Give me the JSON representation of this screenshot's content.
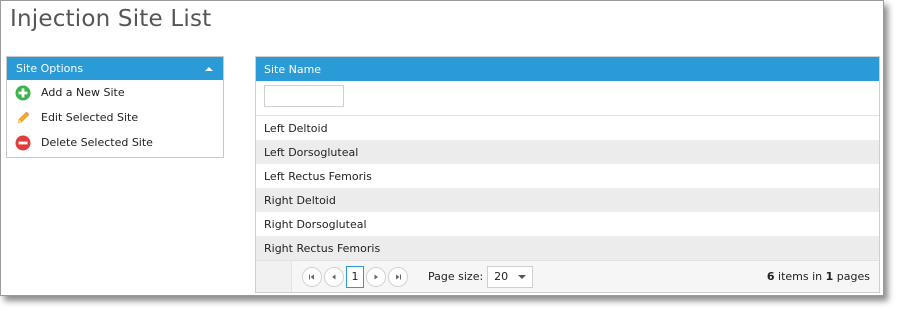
{
  "page": {
    "title": "Injection Site List"
  },
  "options_panel": {
    "header": "Site Options",
    "items": [
      {
        "label": "Add a New Site",
        "icon": "add-circle-icon",
        "color": "#3cb34a"
      },
      {
        "label": "Edit Selected Site",
        "icon": "pencil-icon",
        "color": "#f0b323"
      },
      {
        "label": "Delete Selected Site",
        "icon": "remove-circle-icon",
        "color": "#e23b3b"
      }
    ]
  },
  "grid": {
    "column_header": "Site Name",
    "filter_value": "",
    "rows": [
      "Left Deltoid",
      "Left Dorsogluteal",
      "Left Rectus Femoris",
      "Right Deltoid",
      "Right Dorsogluteal",
      "Right Rectus Femoris"
    ],
    "pager": {
      "current_page": "1",
      "page_size_label": "Page size:",
      "page_size_value": "20",
      "item_count": "6",
      "items_in_text": "items in",
      "page_count": "1",
      "pages_text": "pages"
    }
  },
  "colors": {
    "accent": "#2a9bd6",
    "alt_row": "#ececec"
  }
}
